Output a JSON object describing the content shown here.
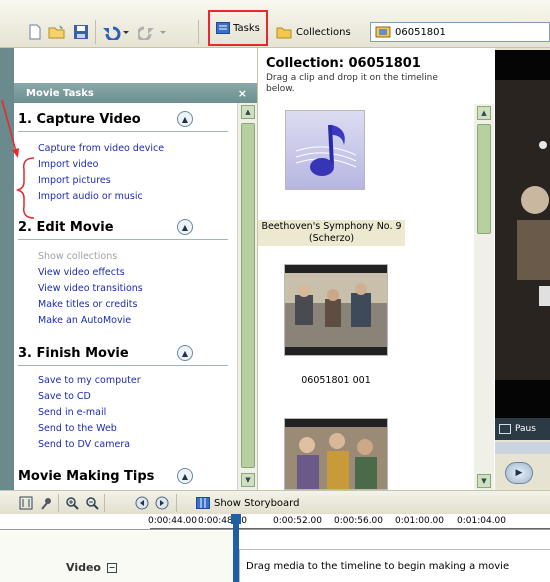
{
  "toolbar": {
    "tasks_label": "Tasks",
    "collections_label": "Collections",
    "collection_value": "06051801"
  },
  "task_pane": {
    "header": "Movie Tasks",
    "close": "×",
    "sections": [
      {
        "title": "1. Capture Video",
        "links": [
          "Capture from video device",
          "Import video",
          "Import pictures",
          "Import audio or music"
        ]
      },
      {
        "title": "2. Edit Movie",
        "links": [
          "Show collections",
          "View video effects",
          "View video transitions",
          "Make titles or credits",
          "Make an AutoMovie"
        ]
      },
      {
        "title": "3. Finish Movie",
        "links": [
          "Save to my computer",
          "Save to CD",
          "Send in e-mail",
          "Send to the Web",
          "Send to DV camera"
        ]
      },
      {
        "title": "Movie Making Tips",
        "links": []
      }
    ]
  },
  "collection": {
    "title": "Collection: 06051801",
    "hint": "Drag a clip and drop it on the timeline below.",
    "clips": [
      {
        "label": "Beethoven's Symphony No. 9 (Scherzo)"
      },
      {
        "label": "06051801 001"
      }
    ]
  },
  "preview": {
    "status": "Paus"
  },
  "timeline": {
    "storyboard_label": "Show Storyboard",
    "ticks": [
      "0:00:44.00",
      "0:00:48.00",
      "0:00:52.00",
      "0:00:56.00",
      "0:01:00.00",
      "0:01:04.00"
    ],
    "video_label": "Video",
    "message": "Drag media to the timeline to begin making a movie"
  },
  "colors": {
    "highlight": "#e8282a",
    "link": "#1b2bb0",
    "pane_header": "#7b9b9b"
  }
}
